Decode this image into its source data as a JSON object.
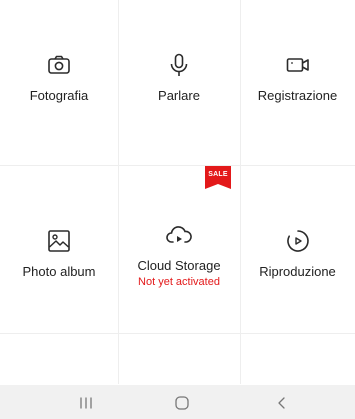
{
  "grid": {
    "items": [
      {
        "label": "Fotografia",
        "icon": "camera-icon"
      },
      {
        "label": "Parlare",
        "icon": "microphone-icon"
      },
      {
        "label": "Registrazione",
        "icon": "video-camera-icon"
      },
      {
        "label": "Photo album",
        "icon": "image-icon"
      },
      {
        "label": "Cloud Storage",
        "sublabel": "Not yet activated",
        "icon": "cloud-play-icon",
        "badge": "SALE"
      },
      {
        "label": "Riproduzione",
        "icon": "replay-icon"
      }
    ]
  },
  "nav": {
    "buttons": [
      "recent-apps-icon",
      "home-icon",
      "back-icon"
    ]
  },
  "colors": {
    "accent_red": "#e3191a",
    "icon": "#2b2b2b",
    "nav_bg": "#f1f1f1"
  }
}
